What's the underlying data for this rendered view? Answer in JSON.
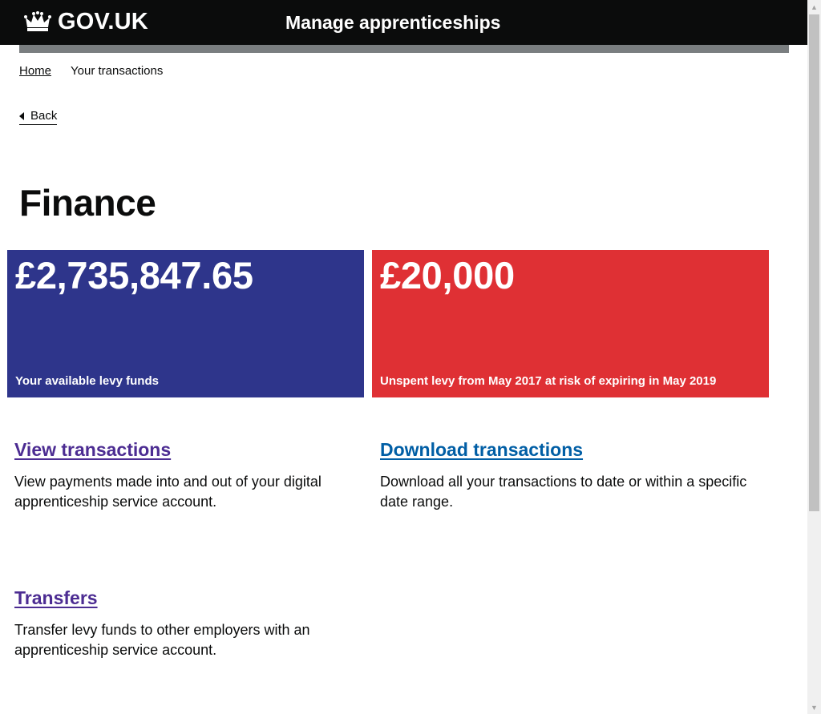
{
  "header": {
    "logo_text": "GOV.UK",
    "service_name": "Manage apprenticeships"
  },
  "breadcrumb": {
    "home": "Home",
    "current": "Your transactions"
  },
  "back_link": "Back",
  "page_title": "Finance",
  "panels": [
    {
      "amount": "£2,735,847.65",
      "caption": "Your available levy funds",
      "color": "#2e358b"
    },
    {
      "amount": "£20,000",
      "caption": "Unspent levy from May 2017 at risk of expiring in May 2019",
      "color": "#df3034"
    }
  ],
  "sections": {
    "view": {
      "link": "View transactions",
      "description": "View payments made into and out of your digital apprenticeship service account."
    },
    "download": {
      "link": "Download transactions",
      "description": "Download all your transactions to date or within a specific date range."
    },
    "transfers": {
      "link": "Transfers",
      "description": "Transfer levy funds to other employers with an apprenticeship service account."
    }
  },
  "colors": {
    "header_bg": "#0b0c0c",
    "visited_link": "#4c2c92",
    "link": "#005ea5"
  },
  "icons": [
    "crown-icon",
    "back-arrow-icon"
  ]
}
